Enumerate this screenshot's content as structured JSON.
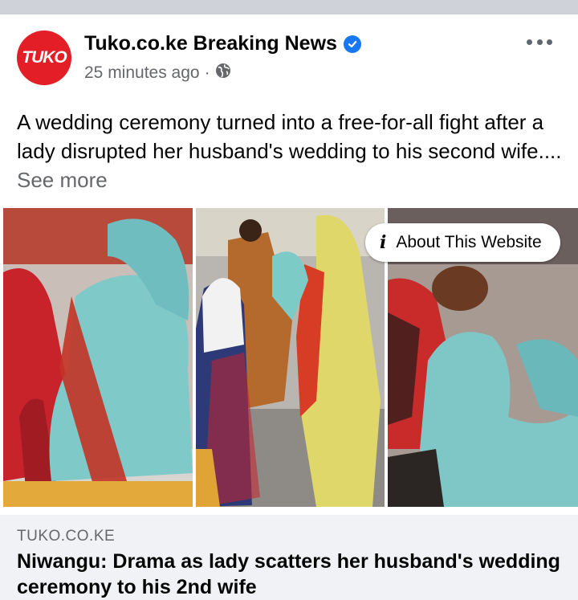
{
  "post": {
    "avatar_text": "TUKO",
    "page_name": "Tuko.co.ke Breaking News",
    "timestamp": "25 minutes ago",
    "separator": "·",
    "caption": "A wedding ceremony turned into a free-for-all fight after a lady disrupted her husband's wedding to his second wife....",
    "see_more": "See more",
    "about_label": "About This Website"
  },
  "link_preview": {
    "domain": "TUKO.CO.KE",
    "headline": "Niwangu: Drama as lady scatters her husband's wedding ceremony to his 2nd wife"
  },
  "icons": {
    "verified": "verified-badge-icon",
    "privacy": "globe-icon",
    "menu": "more-options-icon",
    "info": "info-icon"
  },
  "colors": {
    "brand_red": "#e41e26",
    "verified_blue": "#1877f2",
    "muted_text": "#65676b",
    "link_bg": "#f0f2f5"
  }
}
